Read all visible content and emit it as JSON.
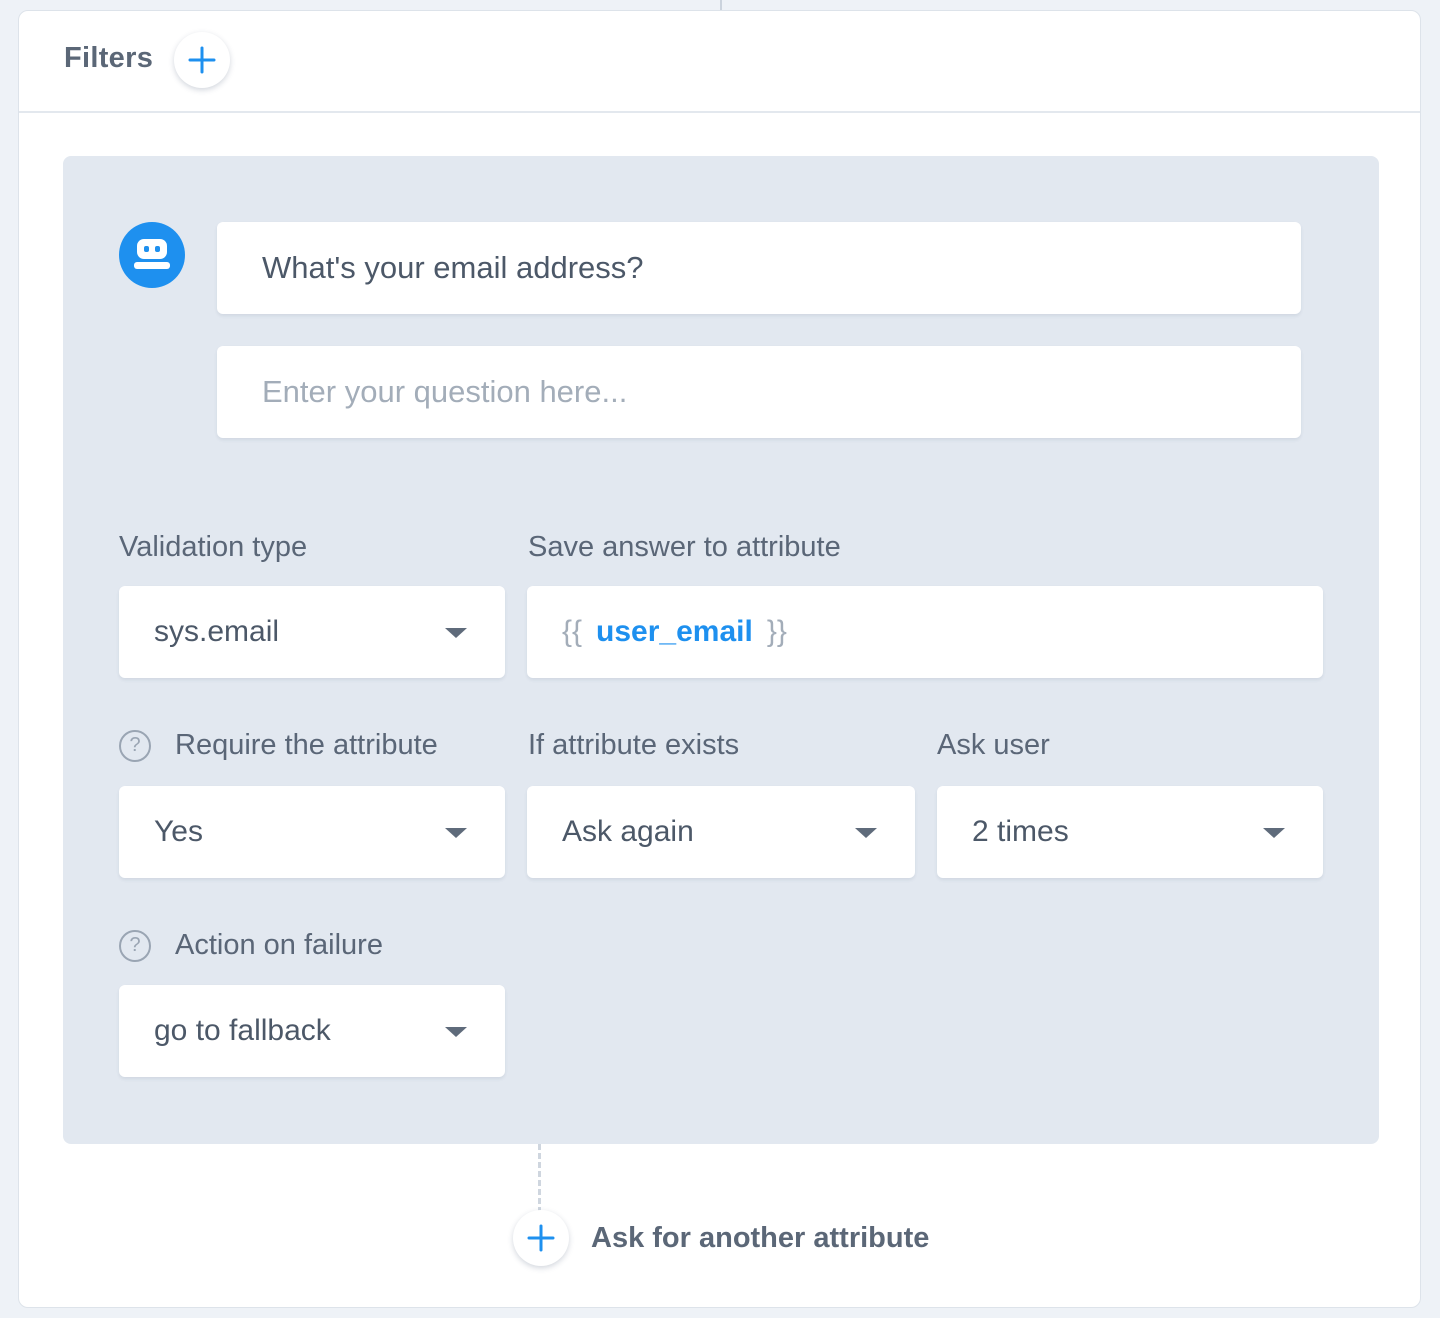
{
  "filters": {
    "title": "Filters"
  },
  "question": {
    "text": "What's your email address?",
    "placeholder": "Enter your question here..."
  },
  "validation_type": {
    "label": "Validation type",
    "value": "sys.email"
  },
  "save_attribute": {
    "label": "Save answer to attribute",
    "open_brace": "{{",
    "attribute": "user_email",
    "close_brace": "}}"
  },
  "require_attribute": {
    "label": "Require the attribute",
    "value": "Yes"
  },
  "if_exists": {
    "label": "If attribute exists",
    "value": "Ask again"
  },
  "ask_user": {
    "label": "Ask user",
    "value": "2 times"
  },
  "action_on_failure": {
    "label": "Action on failure",
    "value": "go to fallback"
  },
  "ask_another": {
    "label": "Ask for another attribute"
  },
  "colors": {
    "accent": "#1e90ef",
    "panel": "#e2e8f0",
    "text": "#4c5868",
    "muted": "#a3adb9"
  },
  "icons": {
    "add": "plus-icon",
    "bot": "robot-icon",
    "help": "question-mark-icon",
    "caret": "caret-down-icon"
  }
}
